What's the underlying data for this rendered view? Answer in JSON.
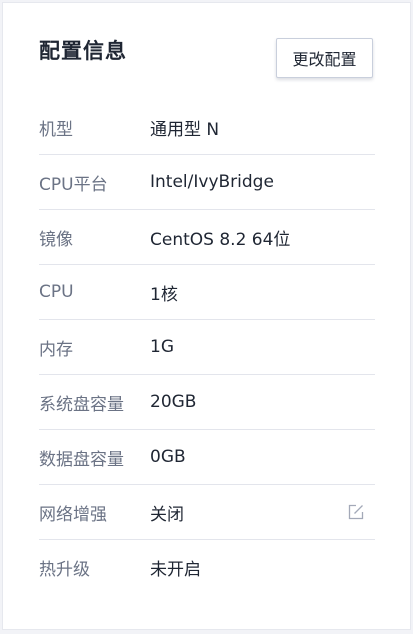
{
  "panel": {
    "title": "配置信息",
    "edit_button_label": "更改配置"
  },
  "config_rows": [
    {
      "label": "机型",
      "value": "通用型 N"
    },
    {
      "label": "CPU平台",
      "value": "Intel/IvyBridge"
    },
    {
      "label": "镜像",
      "value": "CentOS 8.2 64位"
    },
    {
      "label": "CPU",
      "value": "1核"
    },
    {
      "label": "内存",
      "value": "1G"
    },
    {
      "label": "系统盘容量",
      "value": "20GB"
    },
    {
      "label": "数据盘容量",
      "value": "0GB"
    },
    {
      "label": "网络增强",
      "value": "关闭",
      "icon": "edit-icon"
    },
    {
      "label": "热升级",
      "value": "未开启"
    }
  ],
  "colors": {
    "title_text": "#1f2633",
    "label_text": "#6b7385",
    "value_text": "#1f2633",
    "divider": "#e3e5ec",
    "icon": "#a3a9b8"
  }
}
